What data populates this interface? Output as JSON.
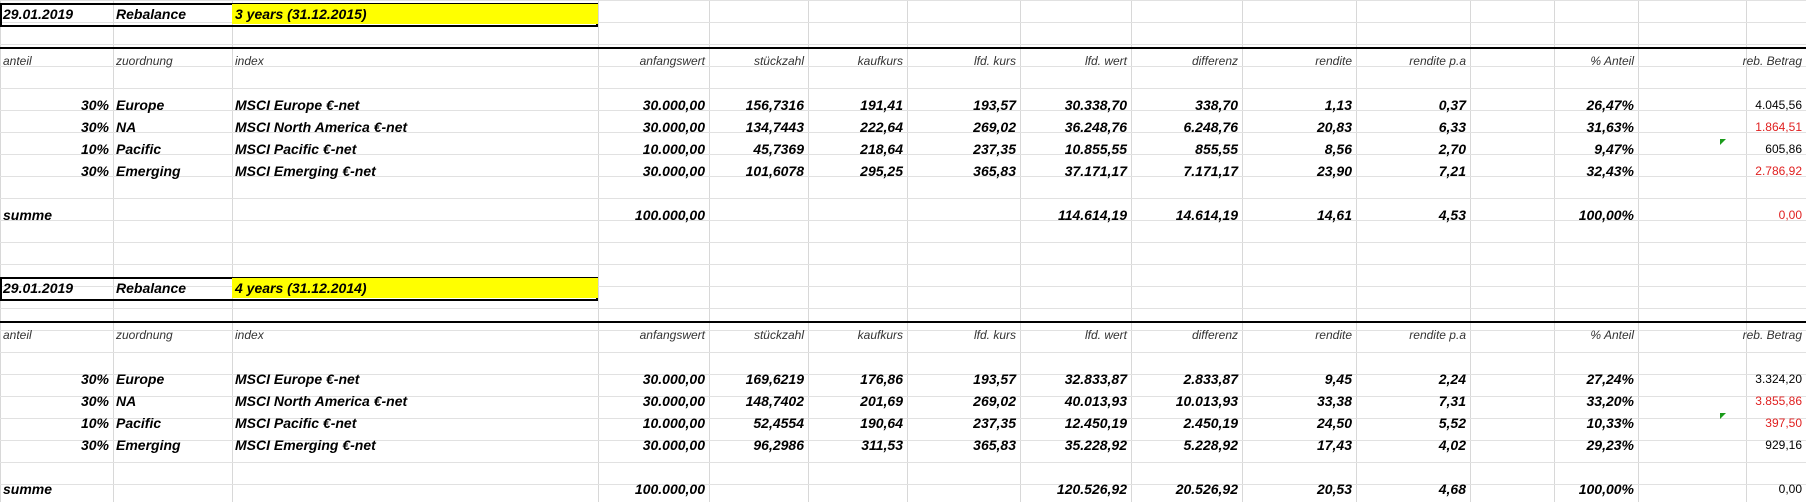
{
  "headers": [
    "anteil",
    "zuordnung",
    "index",
    "anfangswert",
    "stückzahl",
    "kaufkurs",
    "lfd. kurs",
    "lfd. wert",
    "differenz",
    "rendite",
    "rendite p.a",
    "% Anteil",
    "reb. Betrag"
  ],
  "sections": [
    {
      "date": "29.01.2019",
      "label": "Rebalance",
      "period": "3 years (31.12.2015)",
      "rows": [
        {
          "anteil": "30%",
          "zuordnung": "Europe",
          "index": "MSCI Europe €-net",
          "anfangswert": "30.000,00",
          "stueckzahl": "156,7316",
          "kaufkurs": "191,41",
          "lfd_kurs": "193,57",
          "lfd_wert": "30.338,70",
          "differenz": "338,70",
          "rendite": "1,13",
          "rendite_pa": "0,37",
          "anteil_pct": "26,47%",
          "reb_betrag": "4.045,56",
          "reb_red": false,
          "note": false
        },
        {
          "anteil": "30%",
          "zuordnung": "NA",
          "index": "MSCI North America €-net",
          "anfangswert": "30.000,00",
          "stueckzahl": "134,7443",
          "kaufkurs": "222,64",
          "lfd_kurs": "269,02",
          "lfd_wert": "36.248,76",
          "differenz": "6.248,76",
          "rendite": "20,83",
          "rendite_pa": "6,33",
          "anteil_pct": "31,63%",
          "reb_betrag": "1.864,51",
          "reb_red": true,
          "note": false
        },
        {
          "anteil": "10%",
          "zuordnung": "Pacific",
          "index": "MSCI Pacific €-net",
          "anfangswert": "10.000,00",
          "stueckzahl": "45,7369",
          "kaufkurs": "218,64",
          "lfd_kurs": "237,35",
          "lfd_wert": "10.855,55",
          "differenz": "855,55",
          "rendite": "8,56",
          "rendite_pa": "2,70",
          "anteil_pct": "9,47%",
          "reb_betrag": "605,86",
          "reb_red": false,
          "note": true
        },
        {
          "anteil": "30%",
          "zuordnung": "Emerging",
          "index": "MSCI Emerging €-net",
          "anfangswert": "30.000,00",
          "stueckzahl": "101,6078",
          "kaufkurs": "295,25",
          "lfd_kurs": "365,83",
          "lfd_wert": "37.171,17",
          "differenz": "7.171,17",
          "rendite": "23,90",
          "rendite_pa": "7,21",
          "anteil_pct": "32,43%",
          "reb_betrag": "2.786,92",
          "reb_red": true,
          "note": false
        }
      ],
      "sum": {
        "label": "summe",
        "anfangswert": "100.000,00",
        "lfd_wert": "114.614,19",
        "differenz": "14.614,19",
        "rendite": "14,61",
        "rendite_pa": "4,53",
        "anteil_pct": "100,00%",
        "reb_betrag": "0,00",
        "reb_red": true
      }
    },
    {
      "date": "29.01.2019",
      "label": "Rebalance",
      "period": "4 years (31.12.2014)",
      "rows": [
        {
          "anteil": "30%",
          "zuordnung": "Europe",
          "index": "MSCI Europe €-net",
          "anfangswert": "30.000,00",
          "stueckzahl": "169,6219",
          "kaufkurs": "176,86",
          "lfd_kurs": "193,57",
          "lfd_wert": "32.833,87",
          "differenz": "2.833,87",
          "rendite": "9,45",
          "rendite_pa": "2,24",
          "anteil_pct": "27,24%",
          "reb_betrag": "3.324,20",
          "reb_red": false,
          "note": false
        },
        {
          "anteil": "30%",
          "zuordnung": "NA",
          "index": "MSCI North America €-net",
          "anfangswert": "30.000,00",
          "stueckzahl": "148,7402",
          "kaufkurs": "201,69",
          "lfd_kurs": "269,02",
          "lfd_wert": "40.013,93",
          "differenz": "10.013,93",
          "rendite": "33,38",
          "rendite_pa": "7,31",
          "anteil_pct": "33,20%",
          "reb_betrag": "3.855,86",
          "reb_red": true,
          "note": false
        },
        {
          "anteil": "10%",
          "zuordnung": "Pacific",
          "index": "MSCI Pacific €-net",
          "anfangswert": "10.000,00",
          "stueckzahl": "52,4554",
          "kaufkurs": "190,64",
          "lfd_kurs": "237,35",
          "lfd_wert": "12.450,19",
          "differenz": "2.450,19",
          "rendite": "24,50",
          "rendite_pa": "5,52",
          "anteil_pct": "10,33%",
          "reb_betrag": "397,50",
          "reb_red": true,
          "note": true
        },
        {
          "anteil": "30%",
          "zuordnung": "Emerging",
          "index": "MSCI Emerging €-net",
          "anfangswert": "30.000,00",
          "stueckzahl": "96,2986",
          "kaufkurs": "311,53",
          "lfd_kurs": "365,83",
          "lfd_wert": "35.228,92",
          "differenz": "5.228,92",
          "rendite": "17,43",
          "rendite_pa": "4,02",
          "anteil_pct": "29,23%",
          "reb_betrag": "929,16",
          "reb_red": false,
          "note": false
        }
      ],
      "sum": {
        "label": "summe",
        "anfangswert": "100.000,00",
        "lfd_wert": "120.526,92",
        "differenz": "20.526,92",
        "rendite": "20,53",
        "rendite_pa": "4,68",
        "anteil_pct": "100,00%",
        "reb_betrag": "0,00",
        "reb_red": false
      }
    }
  ]
}
